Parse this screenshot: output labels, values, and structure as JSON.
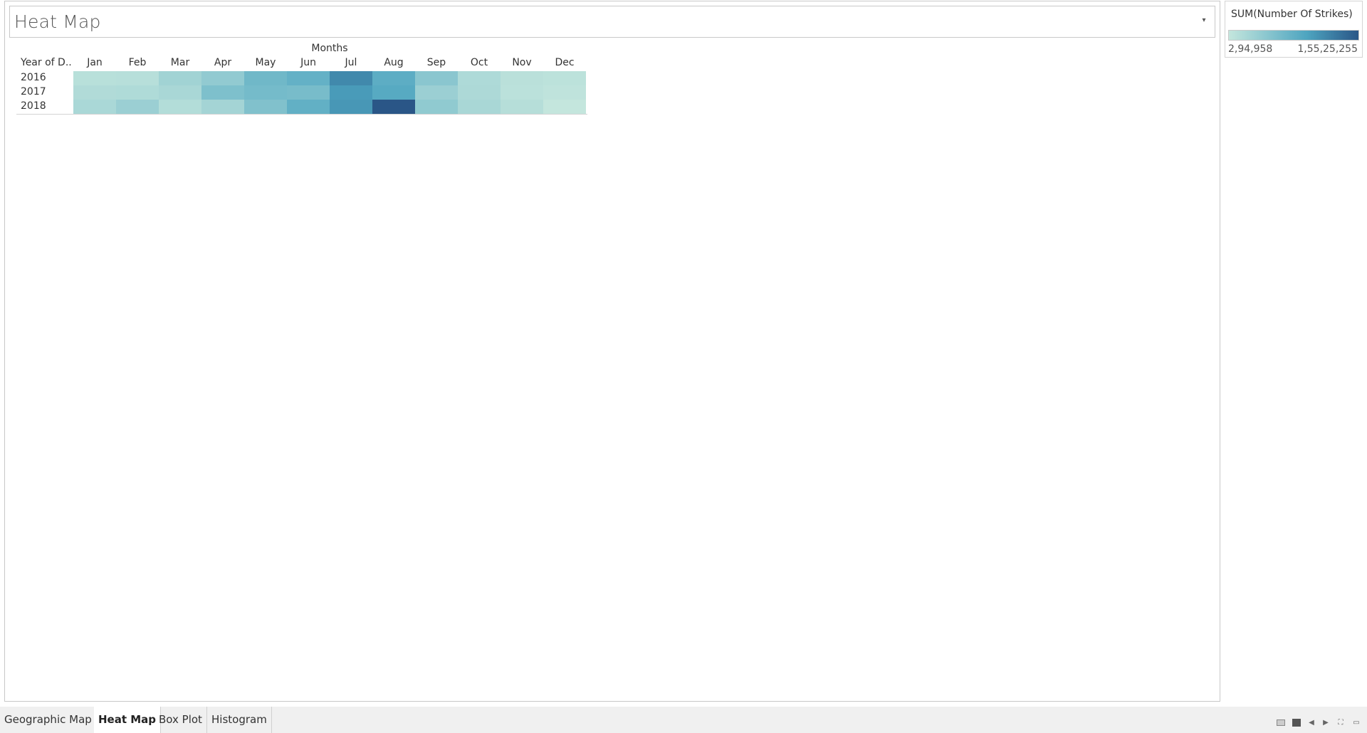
{
  "sheet": {
    "title": "Heat Map"
  },
  "icons": {
    "title_dropdown": "chevron-down-icon",
    "tab_controls": [
      "filmstrip-icon",
      "tiles-icon",
      "previous-icon",
      "next-icon",
      "fullscreen-icon",
      "presentation-icon"
    ]
  },
  "chart_data": {
    "type": "heatmap",
    "column_dimension_label": "Months",
    "row_dimension_label": "Year of D..",
    "columns": [
      "Jan",
      "Feb",
      "Mar",
      "Apr",
      "May",
      "Jun",
      "Jul",
      "Aug",
      "Sep",
      "Oct",
      "Nov",
      "Dec"
    ],
    "rows": [
      "2016",
      "2017",
      "2018"
    ],
    "values": [
      [
        1200000,
        1300000,
        3000000,
        4200000,
        6800000,
        7700000,
        11600000,
        8300000,
        4800000,
        2000000,
        1100000,
        900000
      ],
      [
        1800000,
        1900000,
        2400000,
        5700000,
        6400000,
        6200000,
        10200000,
        8700000,
        3500000,
        2100000,
        1000000,
        700000
      ],
      [
        2300000,
        3500000,
        1600000,
        2800000,
        5500000,
        7900000,
        10500000,
        15525255,
        4300000,
        2400000,
        1400000,
        294958
      ]
    ],
    "color_legend": {
      "title": "SUM(Number Of Strikes)",
      "min_label": "2,94,958",
      "max_label": "1,55,25,255",
      "min_value": 294958,
      "max_value": 15525255,
      "min_color": "#c4e6dd",
      "mid_color": "#4ea5c0",
      "max_color": "#2a5687"
    }
  },
  "tabs": [
    {
      "label": "Geographic Map",
      "active": false
    },
    {
      "label": "Heat Map",
      "active": true
    },
    {
      "label": "Box Plot",
      "active": false
    },
    {
      "label": "Histogram",
      "active": false
    }
  ]
}
